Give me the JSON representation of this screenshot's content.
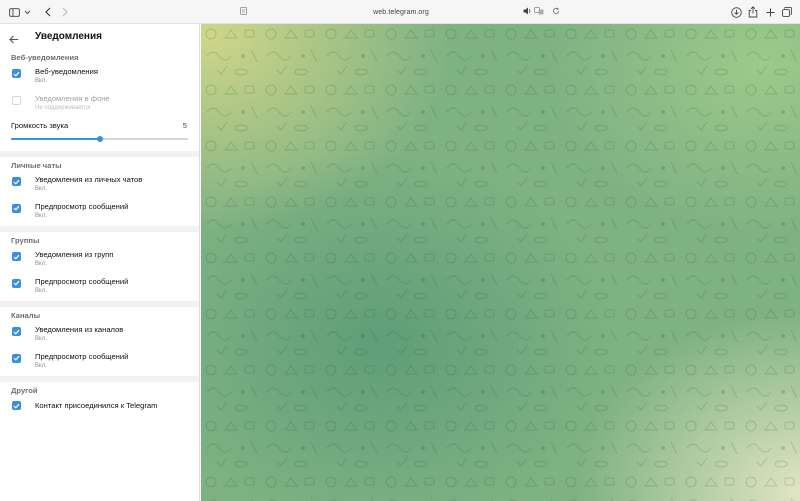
{
  "browser": {
    "url": "web.telegram.org"
  },
  "settings": {
    "title": "Уведомления",
    "web": {
      "section_title": "Веб-уведомления",
      "web_notifications": {
        "label": "Веб-уведомления",
        "status": "Вкл.",
        "checked": true
      },
      "background_notifications": {
        "label": "Уведомления в фоне",
        "status": "Не поддерживается",
        "checked": false,
        "disabled": true
      },
      "volume": {
        "label": "Громкость звука",
        "value": "5",
        "fraction": 0.5
      }
    },
    "private": {
      "section_title": "Личные чаты",
      "notifications": {
        "label": "Уведомления из личных чатов",
        "status": "Вкл."
      },
      "preview": {
        "label": "Предпросмотр сообщений",
        "status": "Вкл."
      }
    },
    "groups": {
      "section_title": "Группы",
      "notifications": {
        "label": "Уведомления из групп",
        "status": "Вкл."
      },
      "preview": {
        "label": "Предпросмотр сообщений",
        "status": "Вкл."
      }
    },
    "channels": {
      "section_title": "Каналы",
      "notifications": {
        "label": "Уведомления из каналов",
        "status": "Вкл."
      },
      "preview": {
        "label": "Предпросмотр сообщений",
        "status": "Вкл."
      }
    },
    "other": {
      "section_title": "Другой",
      "contact_joined": {
        "label": "Контакт присоединился к Telegram"
      }
    }
  },
  "colors": {
    "accent": "#3a90e0"
  },
  "icons": {
    "sidebar": "sidebar-icon",
    "back": "arrow-left-icon",
    "check": "check-icon",
    "download": "download-icon",
    "share": "share-icon",
    "new_tab": "plus-icon",
    "tabs": "tabs-overview-icon"
  }
}
